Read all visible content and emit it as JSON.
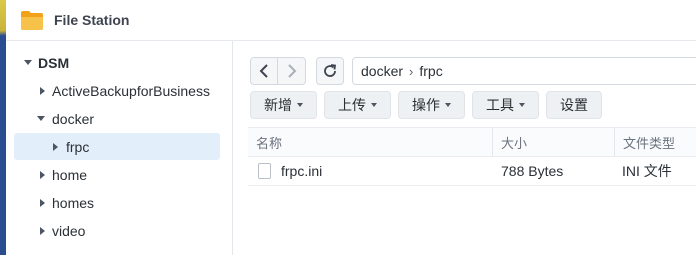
{
  "app": {
    "title": "File Station",
    "icon": "folder-icon"
  },
  "sidebar": {
    "items": [
      {
        "label": "DSM",
        "expanded": true,
        "level": 0
      },
      {
        "label": "ActiveBackupforBusiness",
        "expanded": false,
        "level": 1
      },
      {
        "label": "docker",
        "expanded": true,
        "level": 1
      },
      {
        "label": "frpc",
        "expanded": false,
        "level": 2,
        "selected": true
      },
      {
        "label": "home",
        "expanded": false,
        "level": 1
      },
      {
        "label": "homes",
        "expanded": false,
        "level": 1
      },
      {
        "label": "video",
        "expanded": false,
        "level": 1
      }
    ]
  },
  "path": {
    "segments": [
      "docker",
      "frpc"
    ],
    "separator": "›"
  },
  "toolbar": {
    "create_label": "新增",
    "upload_label": "上传",
    "action_label": "操作",
    "tools_label": "工具",
    "settings_label": "设置"
  },
  "table": {
    "columns": [
      "名称",
      "大小",
      "文件类型"
    ],
    "rows": [
      {
        "name": "frpc.ini",
        "size": "788 Bytes",
        "type": "INI 文件"
      }
    ]
  },
  "colors": {
    "accent": "#e3eefb",
    "folder": "#f5a623",
    "text": "#2b3036"
  }
}
